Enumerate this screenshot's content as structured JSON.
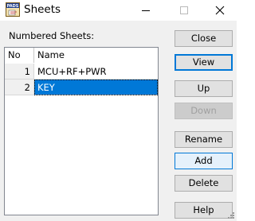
{
  "window": {
    "title": "Sheets",
    "app_icon_text": "PADS",
    "controls": {
      "minimize_icon": "minimize-icon",
      "maximize_icon": "maximize-icon",
      "close_icon": "close-icon"
    }
  },
  "list": {
    "label": "Numbered Sheets:",
    "columns": [
      "No",
      "Name"
    ],
    "rows": [
      {
        "no": "1",
        "name": "MCU+RF+PWR",
        "selected": false
      },
      {
        "no": "2",
        "name": "KEY",
        "selected": true
      }
    ]
  },
  "buttons": {
    "close": "Close",
    "view": "View",
    "up": "Up",
    "down": "Down",
    "rename": "Rename",
    "add": "Add",
    "delete": "Delete",
    "help": "Help"
  },
  "colors": {
    "selection": "#0078d7",
    "accent_border": "#0078d7",
    "dialog_bg": "#f0f0f0"
  }
}
